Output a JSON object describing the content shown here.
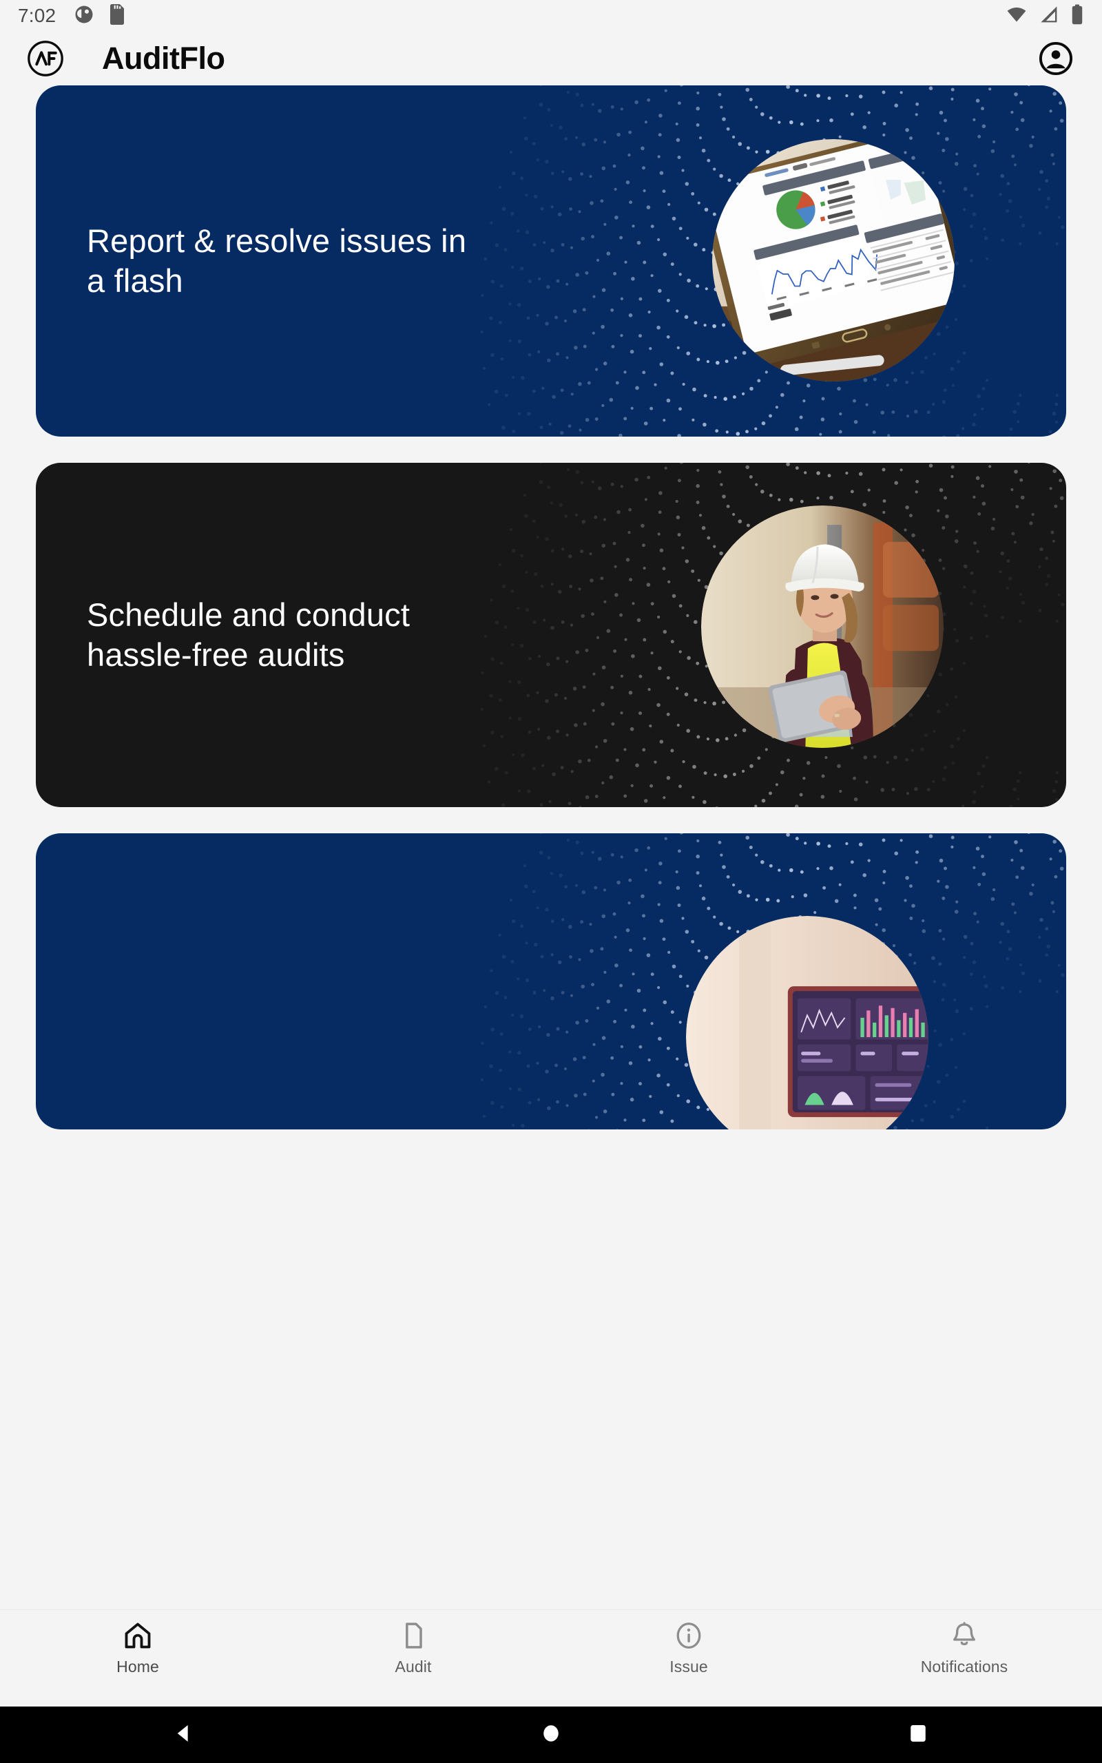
{
  "status_bar": {
    "time": "7:02",
    "left_icons": [
      "dnd-circle-icon",
      "sd-card-icon"
    ],
    "right_icons": [
      "wifi-icon",
      "cellular-signal-icon",
      "battery-icon"
    ]
  },
  "app_bar": {
    "logo_text": "AF",
    "logo_name": "auditflo-logo-icon",
    "title": "AuditFlo",
    "account_icon": "account-circle-icon"
  },
  "feed": {
    "cards": [
      {
        "headline": "Report & resolve issues in a flash",
        "theme": "navy",
        "bg_color": "#062B63",
        "image_name": "tablet-analytics-dashboard-photo",
        "image_alt": "Tablet displaying a traffic analytics dashboard with pie chart and line graph"
      },
      {
        "headline": "Schedule and conduct hassle-free audits",
        "theme": "dark",
        "bg_color": "#171717",
        "image_name": "warehouse-inspector-photo",
        "image_alt": "Female worker in white hard hat and yellow hi-vis vest using a tablet in a warehouse"
      },
      {
        "headline": "",
        "theme": "navy",
        "bg_color": "#062B63",
        "image_name": "desktop-dashboard-photo",
        "image_alt": "Monitor showing a colorful business dashboard"
      }
    ]
  },
  "bottom_nav": {
    "items": [
      {
        "label": "Home",
        "icon": "home-icon",
        "active": true
      },
      {
        "label": "Audit",
        "icon": "document-icon",
        "active": false
      },
      {
        "label": "Issue",
        "icon": "info-circle-icon",
        "active": false
      },
      {
        "label": "Notifications",
        "icon": "bell-icon",
        "active": false
      }
    ]
  },
  "system_nav": {
    "buttons": [
      {
        "name": "back-button",
        "icon": "triangle-left-icon"
      },
      {
        "name": "home-button",
        "icon": "circle-icon"
      },
      {
        "name": "recents-button",
        "icon": "square-icon"
      }
    ]
  },
  "colors": {
    "page_bg": "#F4F4F4",
    "navy": "#062B63",
    "dark": "#171717",
    "text_on_card": "#FFFFFF",
    "nav_label": "#5D5D5D",
    "sysnav_bg": "#000000"
  }
}
